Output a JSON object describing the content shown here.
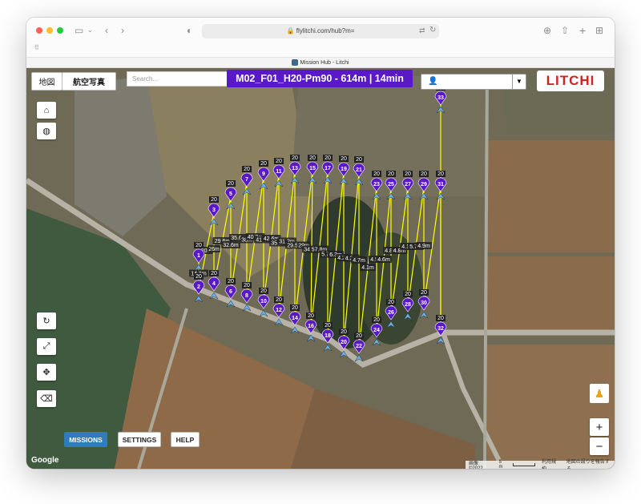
{
  "browser": {
    "url": "flylitchi.com/hub?m=",
    "tab_title": "Mission Hub - Litchi"
  },
  "map_type": {
    "map": "地図",
    "satellite": "航空写真"
  },
  "search": {
    "placeholder": "Search..."
  },
  "mission_title": "M02_F01_H20-Pm90 - 614m | 14min",
  "logo": "LITCHI",
  "nav": {
    "missions": "MISSIONS",
    "settings": "SETTINGS",
    "help": "HELP"
  },
  "footer": {
    "google": "Google",
    "imagery": "画像 ©2022",
    "scale": "5 m",
    "terms": "利用規約",
    "report": "地図の誤りを報告する"
  },
  "waypoint_altitude": "20",
  "waypoints": [
    {
      "n": "1"
    },
    {
      "n": "2"
    },
    {
      "n": "3"
    },
    {
      "n": "4"
    },
    {
      "n": "5"
    },
    {
      "n": "6"
    },
    {
      "n": "7"
    },
    {
      "n": "8"
    },
    {
      "n": "9"
    },
    {
      "n": "10"
    },
    {
      "n": "11"
    },
    {
      "n": "12"
    },
    {
      "n": "13"
    },
    {
      "n": "14"
    },
    {
      "n": "15"
    },
    {
      "n": "16"
    },
    {
      "n": "17"
    },
    {
      "n": "18"
    },
    {
      "n": "19"
    },
    {
      "n": "20"
    },
    {
      "n": "21"
    },
    {
      "n": "22"
    },
    {
      "n": "23"
    },
    {
      "n": "24"
    },
    {
      "n": "25"
    },
    {
      "n": "26"
    },
    {
      "n": "27"
    },
    {
      "n": "28"
    },
    {
      "n": "29"
    },
    {
      "n": "30"
    },
    {
      "n": "31"
    },
    {
      "n": "32"
    },
    {
      "n": "33"
    }
  ],
  "segment_distances": [
    "14.1m",
    "20m",
    "26m",
    "29.6m",
    "32.6m",
    "35.6m",
    "38m",
    "40.3m",
    "41.1m",
    "42.6m",
    "35.3m",
    "31.2m",
    "29.5m",
    "29m",
    "34.7m",
    "57.8m",
    "5.7m",
    "6.3m",
    "4.2m",
    "4.2m",
    "4.7m",
    "4.1m",
    "4.5m",
    "4.6m",
    "4.8m",
    "4.8m",
    "4.1m",
    "5.7m",
    "4.9m"
  ],
  "colors": {
    "accent": "#5a19c8",
    "path": "#ffff00",
    "missions_bg": "#2f7bbd",
    "logo": "#d42222"
  }
}
